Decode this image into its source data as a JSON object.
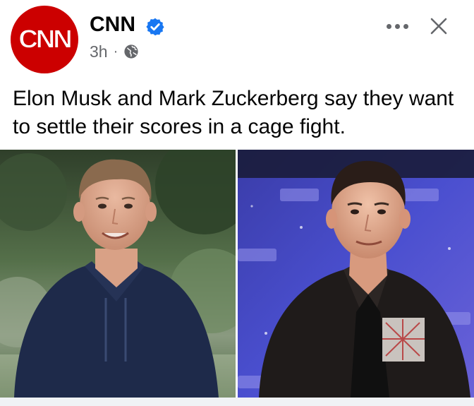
{
  "post": {
    "page_name": "CNN",
    "avatar_text": "CNN",
    "time": "3h",
    "separator": "·",
    "audience_icon": "globe-icon",
    "verified_icon": "verified-badge-icon",
    "more_icon": "more-options-icon",
    "close_icon": "close-icon",
    "text": "Elon Musk and Mark Zuckerberg say they want to settle their scores in a cage fight."
  },
  "photos": [
    {
      "subject": "Mark Zuckerberg"
    },
    {
      "subject": "Elon Musk"
    }
  ],
  "colors": {
    "brand_red": "#cc0000",
    "verified_blue": "#1877f2",
    "secondary_text": "#65676b"
  }
}
